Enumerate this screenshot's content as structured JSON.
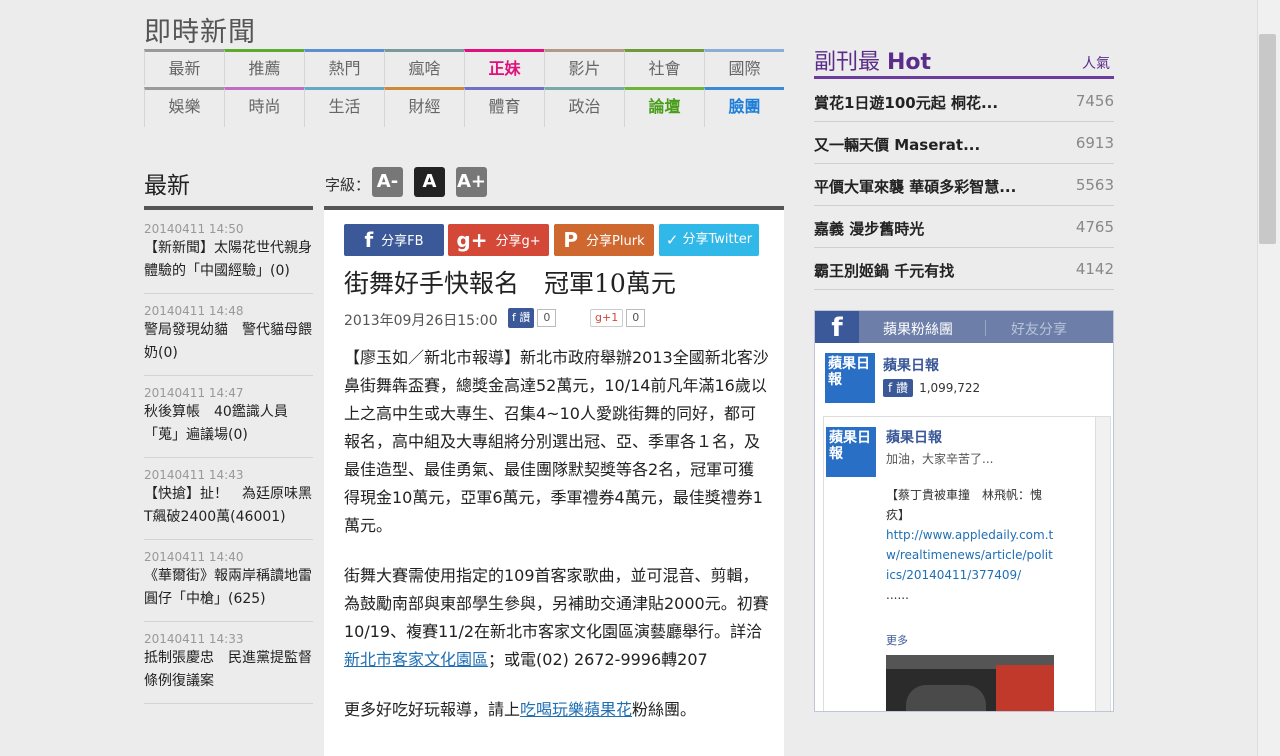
{
  "site": {
    "title": "即時新聞"
  },
  "categories": [
    {
      "label": "最新",
      "color": "#9a9a9a",
      "style": ""
    },
    {
      "label": "推薦",
      "color": "#5cab2e",
      "style": ""
    },
    {
      "label": "熱門",
      "color": "#5b8fcf",
      "style": ""
    },
    {
      "label": "瘋啥",
      "color": "#7a9a9a",
      "style": ""
    },
    {
      "label": "正妹",
      "color": "#e0107e",
      "style": "hot"
    },
    {
      "label": "影片",
      "color": "#b39a86",
      "style": ""
    },
    {
      "label": "社會",
      "color": "#6f9a3a",
      "style": ""
    },
    {
      "label": "國際",
      "color": "#8aaed4",
      "style": ""
    },
    {
      "label": "娛樂",
      "color": "#9a9a9a",
      "style": ""
    },
    {
      "label": "時尚",
      "color": "#c06dc4",
      "style": ""
    },
    {
      "label": "生活",
      "color": "#66a9c4",
      "style": ""
    },
    {
      "label": "財經",
      "color": "#cc8a3a",
      "style": ""
    },
    {
      "label": "體育",
      "color": "#7070c4",
      "style": ""
    },
    {
      "label": "政治",
      "color": "#7aa9a9",
      "style": ""
    },
    {
      "label": "論壇",
      "color": "#6cb43a",
      "style": "forum"
    },
    {
      "label": "臉團",
      "color": "#3a8ad8",
      "style": "face"
    }
  ],
  "latest": {
    "title": "最新",
    "items": [
      {
        "time": "20140411 14:50",
        "text": "【新新聞】太陽花世代親身體驗的「中國經驗」(0)"
      },
      {
        "time": "20140411 14:48",
        "text": "警局發現幼貓　警代貓母餵奶(0)"
      },
      {
        "time": "20140411 14:47",
        "text": "秋後算帳　40鑑識人員「蒐」遍議場(0)"
      },
      {
        "time": "20140411 14:43",
        "text": "【快搶】扯！　為廷原味黑T飆破2400萬(46001)"
      },
      {
        "time": "20140411 14:40",
        "text": "《華爾街》報兩岸稱讀地雷　圓仔「中槍」(625)"
      },
      {
        "time": "20140411 14:33",
        "text": "抵制張慶忠　民進黨提監督條例復議案"
      }
    ]
  },
  "font_size": {
    "label": "字級：",
    "small": "A-",
    "normal": "A",
    "large": "A+"
  },
  "share": {
    "fb": "分享FB",
    "gplus": "分享g+",
    "plurk": "分享Plurk",
    "twitter": "分享Twitter"
  },
  "article": {
    "title": "街舞好手快報名　冠軍10萬元",
    "date": "2013年09月26日15:00",
    "like_label": "讚",
    "like_count": "0",
    "gplus_label": "+1",
    "gplus_count": "0",
    "p1": "【廖玉如／新北市報導】新北市政府舉辦2013全國新北客沙鼻街舞犇盃賽，總獎金高達52萬元，10/14前凡年滿16歲以上之高中生或大專生、召集4~10人愛跳街舞的同好，都可報名，高中組及大專組將分別選出冠、亞、季軍各１名，及最佳造型、最佳勇氣、最佳團隊默契獎等各2名，冠軍可獲得現金10萬元，亞軍6萬元，季軍禮券4萬元，最佳獎禮券1萬元。",
    "p2_a": "街舞大賽需使用指定的109首客家歌曲，並可混音、剪輯，為鼓勵南部與東部學生參與，另補助交通津貼2000元。初賽10/19、複賽11/2在新北市客家文化園區演藝廳舉行。詳洽",
    "p2_link": "新北市客家文化園區",
    "p2_b": "；或電(02) 2672-9996轉207",
    "p3_a": "更多好吃好玩報導，請上",
    "p3_link": "吃喝玩樂蘋果花",
    "p3_b": "粉絲團。"
  },
  "hot": {
    "title_a": "副刊最 ",
    "title_b": "Hot",
    "popular": "人氣",
    "items": [
      {
        "title": "賞花1日遊100元起 桐花...",
        "count": "7456"
      },
      {
        "title": "又一輛天價 Maserat...",
        "count": "6913"
      },
      {
        "title": "平價大軍來襲 華碩多彩智慧...",
        "count": "5563"
      },
      {
        "title": "嘉義 漫步舊時光",
        "count": "4765"
      },
      {
        "title": "霸王別姬鍋 千元有找",
        "count": "4142"
      }
    ]
  },
  "fb": {
    "tab_fans": "蘋果粉絲團",
    "tab_share": "好友分享",
    "page_name": "蘋果日報",
    "avatar_text": "蘋果日報",
    "like_label": "讚",
    "like_count": "1,099,722",
    "post_name": "蘋果日報",
    "post_line": "加油，大家辛苦了...",
    "post_title": "【蔡丁貴被車撞　林飛帆：愧疚】",
    "post_link": "http://www.appledaily.com.tw/realtimenews/article/politics/20140411/377409/",
    "post_dots": "......",
    "more": "更多"
  }
}
